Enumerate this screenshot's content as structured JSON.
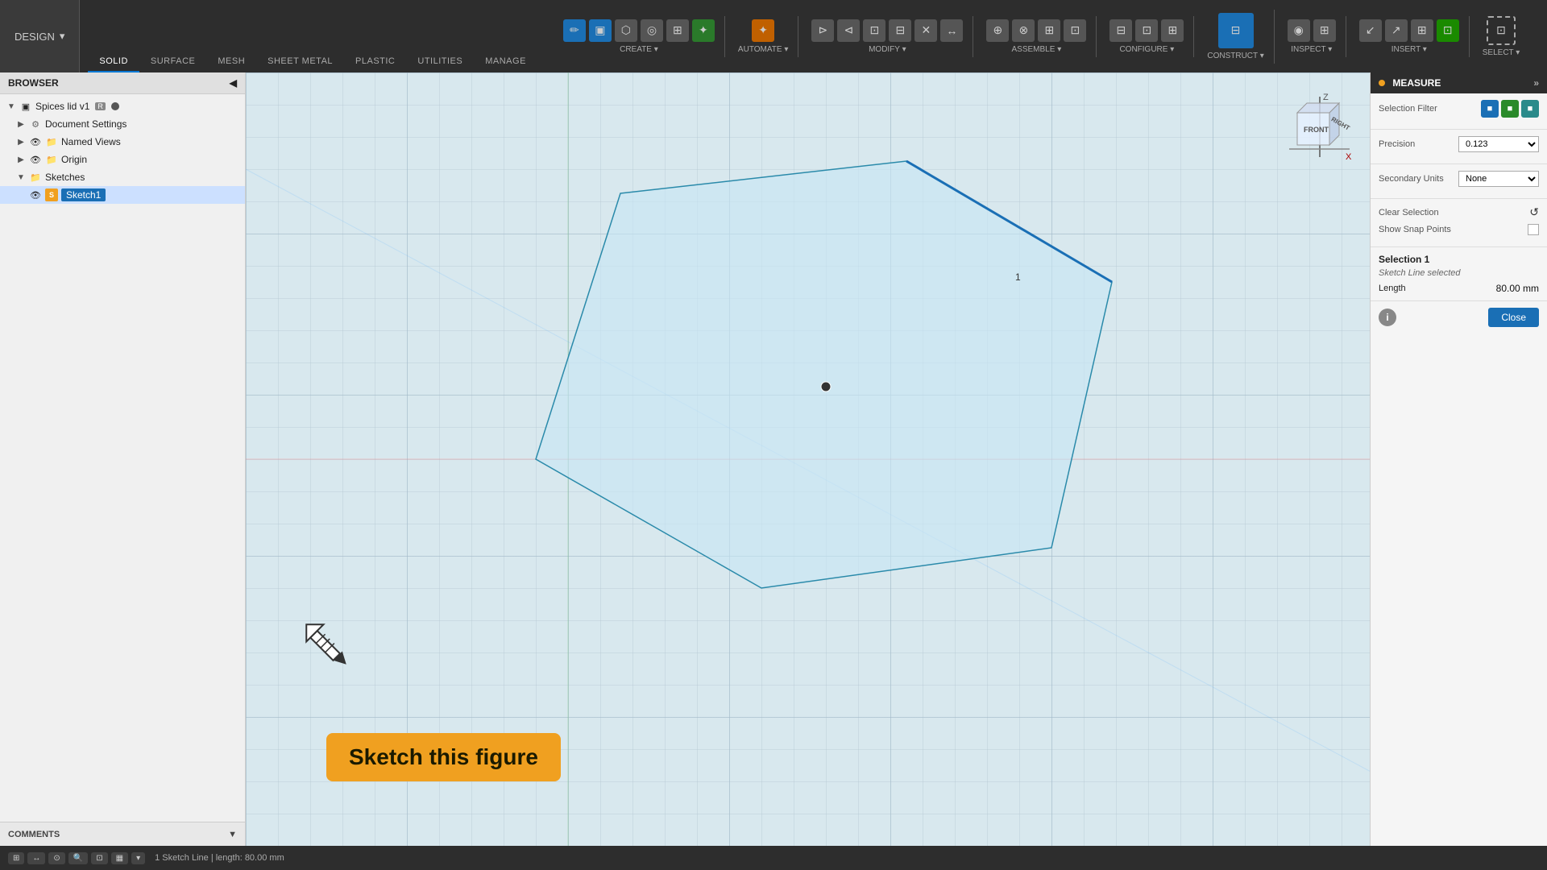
{
  "app": {
    "design_label": "DESIGN",
    "tabs": [
      "SOLID",
      "SURFACE",
      "MESH",
      "SHEET METAL",
      "PLASTIC",
      "UTILITIES",
      "MANAGE"
    ],
    "active_tab": "SOLID"
  },
  "toolbar": {
    "groups": [
      {
        "label": "CREATE",
        "icons": [
          "➕",
          "▣",
          "⬡",
          "◎",
          "⊞",
          "✦"
        ]
      },
      {
        "label": "AUTOMATE",
        "icons": [
          "✂",
          "⊙",
          "⊘"
        ]
      },
      {
        "label": "MODIFY",
        "icons": [
          "⊳",
          "⊲",
          "⊡",
          "⊟",
          "✕",
          "↔"
        ]
      },
      {
        "label": "ASSEMBLE",
        "icons": [
          "⊕",
          "⊗",
          "⊞",
          "⊡"
        ]
      },
      {
        "label": "CONFIGURE",
        "icons": [
          "⊟",
          "⊡",
          "⊞"
        ]
      },
      {
        "label": "CONSTRUCT",
        "icons": [
          "⊟"
        ]
      },
      {
        "label": "INSPECT",
        "icons": [
          "◉",
          "⊞"
        ]
      },
      {
        "label": "INSERT",
        "icons": [
          "↙",
          "↗",
          "⊞",
          "⊡"
        ]
      },
      {
        "label": "SELECT",
        "icons": [
          "⊡"
        ]
      }
    ]
  },
  "sidebar": {
    "header": "BROWSER",
    "items": [
      {
        "id": "root",
        "label": "Spices lid v1",
        "indent": 0,
        "type": "root",
        "tags": [
          "R",
          "●"
        ]
      },
      {
        "id": "doc-settings",
        "label": "Document Settings",
        "indent": 1,
        "type": "gear"
      },
      {
        "id": "named-views",
        "label": "Named Views",
        "indent": 1,
        "type": "folder"
      },
      {
        "id": "origin",
        "label": "Origin",
        "indent": 1,
        "type": "folder"
      },
      {
        "id": "sketches",
        "label": "Sketches",
        "indent": 1,
        "type": "folder"
      },
      {
        "id": "sketch1",
        "label": "Sketch1",
        "indent": 2,
        "type": "sketch",
        "selected": true
      }
    ]
  },
  "measure_panel": {
    "title": "MEASURE",
    "selection_filter_label": "Selection Filter",
    "precision_label": "Precision",
    "precision_value": "0.123",
    "secondary_units_label": "Secondary Units",
    "secondary_units_value": "None",
    "clear_selection_label": "Clear Selection",
    "show_snap_points_label": "Show Snap Points",
    "selection_section_title": "Selection 1",
    "selection_sub": "Sketch Line selected",
    "length_label": "Length",
    "length_value": "80.00 mm",
    "close_label": "Close"
  },
  "sketch_tooltip": {
    "text": "Sketch this figure"
  },
  "canvas": {
    "number_label": "1"
  },
  "statusbar": {
    "items": [
      "1 Sketch Line | length: 80.00 mm"
    ],
    "controls": [
      "⊞",
      "↔",
      "⊙",
      "🔍",
      "⊡",
      "▦",
      "⊟"
    ]
  },
  "comments": {
    "label": "COMMENTS"
  }
}
